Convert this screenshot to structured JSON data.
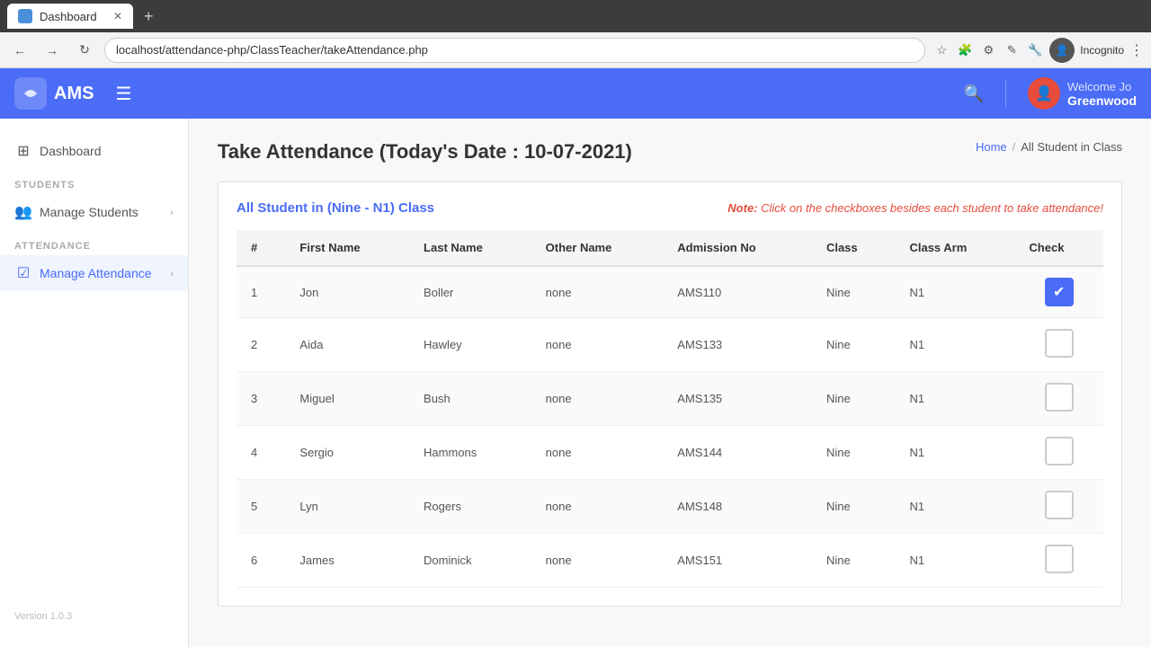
{
  "browser": {
    "tab_title": "Dashboard",
    "url": "localhost/attendance-php/ClassTeacher/takeAttendance.php",
    "new_tab_icon": "+",
    "back_icon": "←",
    "forward_icon": "→",
    "refresh_icon": "↻",
    "user_label": "Incognito"
  },
  "nav": {
    "logo_text": "AMS",
    "hamburger_label": "☰",
    "search_label": "🔍",
    "welcome_text": "Welcome Jo",
    "user_name": "Greenwood"
  },
  "sidebar": {
    "dashboard_label": "Dashboard",
    "students_section": "STUDENTS",
    "manage_students_label": "Manage Students",
    "attendance_section": "ATTENDANCE",
    "manage_attendance_label": "Manage Attendance",
    "version": "Version 1.0.3"
  },
  "page": {
    "title": "Take Attendance (Today's Date : 10-07-2021)",
    "breadcrumb_home": "Home",
    "breadcrumb_sep": "/",
    "breadcrumb_current": "All Student in Class",
    "class_label": "All Student in (Nine - N1) Class",
    "note_prefix": "Note: ",
    "note_text": "Click on the checkboxes besides each student to take attendance!"
  },
  "table": {
    "columns": [
      "#",
      "First Name",
      "Last Name",
      "Other Name",
      "Admission No",
      "Class",
      "Class Arm",
      "Check"
    ],
    "rows": [
      {
        "num": 1,
        "first": "Jon",
        "last": "Boller",
        "other": "none",
        "admission": "AMS110",
        "class": "Nine",
        "arm": "N1",
        "checked": true
      },
      {
        "num": 2,
        "first": "Aida",
        "last": "Hawley",
        "other": "none",
        "admission": "AMS133",
        "class": "Nine",
        "arm": "N1",
        "checked": false
      },
      {
        "num": 3,
        "first": "Miguel",
        "last": "Bush",
        "other": "none",
        "admission": "AMS135",
        "class": "Nine",
        "arm": "N1",
        "checked": false
      },
      {
        "num": 4,
        "first": "Sergio",
        "last": "Hammons",
        "other": "none",
        "admission": "AMS144",
        "class": "Nine",
        "arm": "N1",
        "checked": false
      },
      {
        "num": 5,
        "first": "Lyn",
        "last": "Rogers",
        "other": "none",
        "admission": "AMS148",
        "class": "Nine",
        "arm": "N1",
        "checked": false
      },
      {
        "num": 6,
        "first": "James",
        "last": "Dominick",
        "other": "none",
        "admission": "AMS151",
        "class": "Nine",
        "arm": "N1",
        "checked": false
      }
    ]
  }
}
